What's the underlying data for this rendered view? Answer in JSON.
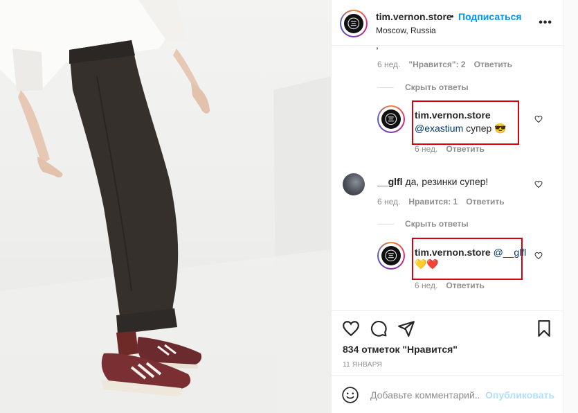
{
  "post": {
    "username": "tim.vernon.store",
    "separator": "•",
    "follow_label": "Подписаться",
    "location": "Moscow, Russia",
    "more_label": "•••"
  },
  "comments": {
    "top_fragment": ",",
    "top_meta": {
      "age": "6 нед.",
      "likes": "\"Нравится\": 2",
      "reply": "Ответить"
    },
    "hide_replies_1": "Скрыть ответы",
    "reply_1": {
      "username": "tim.vernon.store",
      "mention": "@exastium",
      "text": " супер ",
      "emoji": "😎",
      "age": "6 нед.",
      "reply": "Ответить"
    },
    "comment_2": {
      "username": "__glfl",
      "text": " да, резинки супер!",
      "age": "6 нед.",
      "likes": "Нравится: 1",
      "reply": "Ответить"
    },
    "hide_replies_2": "Скрыть ответы",
    "reply_2": {
      "username": "tim.vernon.store",
      "mention": "@__glfl",
      "emoji": "💛❤️",
      "age": "6 нед.",
      "reply": "Ответить"
    }
  },
  "actions": {
    "icons": [
      "heart-icon",
      "comment-icon",
      "share-icon",
      "bookmark-icon"
    ],
    "likes_text": "834 отметок \"Нравится\"",
    "date": "11 ЯНВАРЯ"
  },
  "add_comment": {
    "placeholder": "Добавьте комментарий...",
    "publish_label": "Опубликовать"
  },
  "colors": {
    "accent": "#0095f6",
    "highlight_box": "#d9000d",
    "muted": "#8e8e8e"
  }
}
